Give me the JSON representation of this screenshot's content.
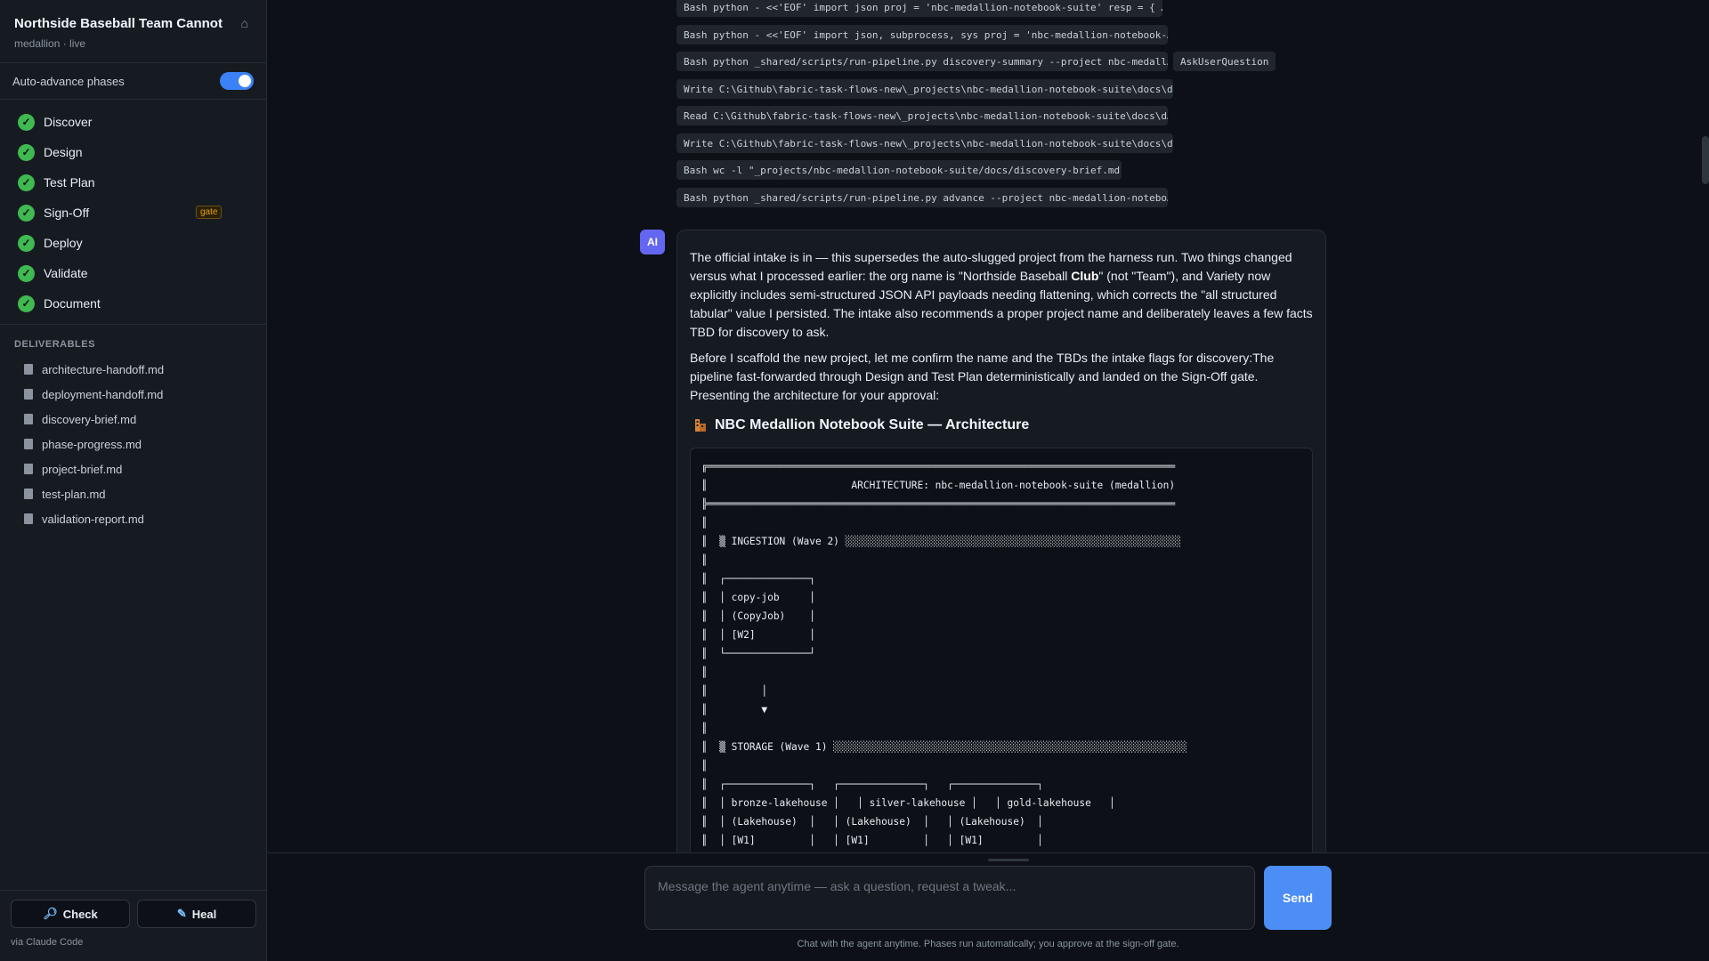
{
  "sidebar": {
    "project_title": "Northside Baseball Team Cannot",
    "project_subtitle": "medallion · live",
    "auto_advance_label": "Auto-advance phases",
    "auto_advance_on": true,
    "phases": [
      {
        "label": "Discover",
        "status": "done"
      },
      {
        "label": "Design",
        "status": "done"
      },
      {
        "label": "Test Plan",
        "status": "done"
      },
      {
        "label": "Sign-Off",
        "status": "done",
        "badge": "gate"
      },
      {
        "label": "Deploy",
        "status": "done"
      },
      {
        "label": "Validate",
        "status": "done"
      },
      {
        "label": "Document",
        "status": "done"
      }
    ],
    "deliverables_heading": "DELIVERABLES",
    "deliverables": [
      "architecture-handoff.md",
      "deployment-handoff.md",
      "discovery-brief.md",
      "phase-progress.md",
      "project-brief.md",
      "test-plan.md",
      "validation-report.md"
    ],
    "check_label": "Check",
    "heal_label": "Heal",
    "via_label": "via Claude Code"
  },
  "tool_calls": [
    "Bash python - <<'EOF' import json proj = 'nbc-medallion-notebook-suite' resp = { …",
    "Bash python - <<'EOF' import json, subprocess, sys proj = 'nbc-medallion-notebook-…",
    "Bash python _shared/scripts/run-pipeline.py discovery-summary --project nbc-medall…",
    "Write C:\\Github\\fabric-task-flows-new\\_projects\\nbc-medallion-notebook-suite\\docs\\d…",
    "Read C:\\Github\\fabric-task-flows-new\\_projects\\nbc-medallion-notebook-suite\\docs\\d…",
    "Write C:\\Github\\fabric-task-flows-new\\_projects\\nbc-medallion-notebook-suite\\docs\\d…",
    "Bash wc -l \"_projects/nbc-medallion-notebook-suite/docs/discovery-brief.md\"",
    "Bash python _shared/scripts/run-pipeline.py advance --project nbc-medallion-notebo…"
  ],
  "ask_user_chip": "AskUserQuestion",
  "message": {
    "avatar": "AI",
    "p1_a": "The official intake is in — this supersedes the auto-slugged project from the harness run. Two things changed versus what I processed earlier: the org name is \"Northside Baseball ",
    "p1_bold": "Club",
    "p1_b": "\" (not \"Team\"), and Variety now explicitly includes semi-structured JSON API payloads needing flattening, which corrects the \"all structured tabular\" value I persisted. The intake also recommends a proper project name and deliberately leaves a few facts TBD for discovery to ask.",
    "p2": "Before I scaffold the new project, let me confirm the name and the TBDs the intake flags for discovery:The pipeline fast-forwarded through Design and Test Plan deterministically and landed on the Sign-Off gate. Presenting the architecture for your approval:",
    "arch_icon": "building-icon",
    "arch_title": "NBC Medallion Notebook Suite — Architecture",
    "diagram_text": "╔══════════════════════════════════════════════════════════════════════════════\n║                        ARCHITECTURE: nbc-medallion-notebook-suite (medallion)\n╠══════════════════════════════════════════════════════════════════════════════\n║\n║  ▒ INGESTION (Wave 2) ░░░░░░░░░░░░░░░░░░░░░░░░░░░░░░░░░░░░░░░░░░░░░░░░░░░░░░░░\n║\n║  ┌──────────────┐\n║  │ copy-job     │\n║  │ (CopyJob)    │\n║  │ [W2]         │\n║  └──────────────┘\n║\n║         │\n║         ▼\n║\n║  ▒ STORAGE (Wave 1) ░░░░░░░░░░░░░░░░░░░░░░░░░░░░░░░░░░░░░░░░░░░░░░░░░░░░░░░░░░░\n║\n║  ┌──────────────┐   ┌──────────────┐   ┌──────────────┐\n║  │ bronze-lakehouse │   │ silver-lakehouse │   │ gold-lakehouse   │\n║  │ (Lakehouse)  │   │ (Lakehouse)  │   │ (Lakehouse)  │\n║  │ [W1]         │   │ [W1]         │   │ [W1]         │\n║  └──────────────┘   └──────────────┘   └──────────────┘\n║\n║         │\n║         ▼"
  },
  "composer": {
    "placeholder": "Message the agent anytime — ask a question, request a tweak...",
    "send_label": "Send",
    "footnote": "Chat with the agent anytime. Phases run automatically; you approve at the sign-off gate."
  },
  "colors": {
    "accent": "#4c8df6",
    "success": "#3fb950",
    "gate": "#e3a008",
    "avatar": "#6366f1"
  }
}
